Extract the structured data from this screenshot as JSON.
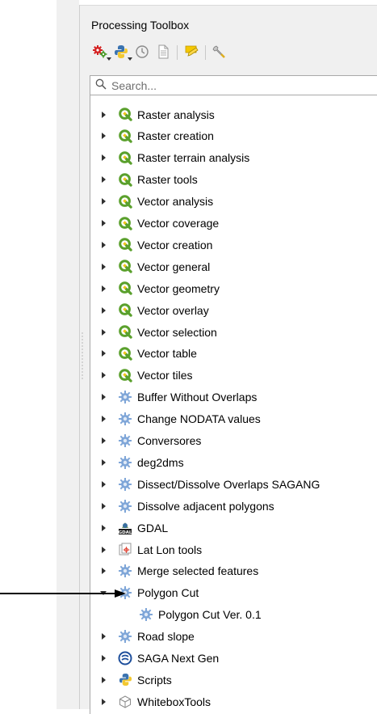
{
  "panel": {
    "title": "Processing Toolbox"
  },
  "toolbar": {
    "buttons": [
      {
        "name": "models-button",
        "icon": "gears-red-icon"
      },
      {
        "name": "scripts-button",
        "icon": "python-icon"
      },
      {
        "name": "history-button",
        "icon": "clock-icon"
      },
      {
        "name": "results-viewer-button",
        "icon": "document-icon"
      },
      {
        "name": "edit-features-in-place-button",
        "icon": "pencil-icon"
      },
      {
        "name": "options-button",
        "icon": "wrench-icon"
      }
    ]
  },
  "search": {
    "placeholder": "Search...",
    "value": ""
  },
  "tree": {
    "items": [
      {
        "label": "Raster analysis",
        "icon": "qgis-icon",
        "expanded": false
      },
      {
        "label": "Raster creation",
        "icon": "qgis-icon",
        "expanded": false
      },
      {
        "label": "Raster terrain analysis",
        "icon": "qgis-icon",
        "expanded": false
      },
      {
        "label": "Raster tools",
        "icon": "qgis-icon",
        "expanded": false
      },
      {
        "label": "Vector analysis",
        "icon": "qgis-icon",
        "expanded": false
      },
      {
        "label": "Vector coverage",
        "icon": "qgis-icon",
        "expanded": false
      },
      {
        "label": "Vector creation",
        "icon": "qgis-icon",
        "expanded": false
      },
      {
        "label": "Vector general",
        "icon": "qgis-icon",
        "expanded": false
      },
      {
        "label": "Vector geometry",
        "icon": "qgis-icon",
        "expanded": false
      },
      {
        "label": "Vector overlay",
        "icon": "qgis-icon",
        "expanded": false
      },
      {
        "label": "Vector selection",
        "icon": "qgis-icon",
        "expanded": false
      },
      {
        "label": "Vector table",
        "icon": "qgis-icon",
        "expanded": false
      },
      {
        "label": "Vector tiles",
        "icon": "qgis-icon",
        "expanded": false
      },
      {
        "label": "Buffer Without Overlaps",
        "icon": "gear-icon",
        "expanded": false
      },
      {
        "label": "Change NODATA values",
        "icon": "gear-icon",
        "expanded": false
      },
      {
        "label": "Conversores",
        "icon": "gear-icon",
        "expanded": false
      },
      {
        "label": "deg2dms",
        "icon": "gear-icon",
        "expanded": false
      },
      {
        "label": "Dissect/Dissolve Overlaps SAGANG",
        "icon": "gear-icon",
        "expanded": false
      },
      {
        "label": "Dissolve adjacent polygons",
        "icon": "gear-icon",
        "expanded": false
      },
      {
        "label": "GDAL",
        "icon": "gdal-icon",
        "expanded": false
      },
      {
        "label": "Lat Lon tools",
        "icon": "latlon-icon",
        "expanded": false
      },
      {
        "label": "Merge selected features",
        "icon": "gear-icon",
        "expanded": false
      },
      {
        "label": "Polygon Cut",
        "icon": "gear-icon",
        "expanded": true
      },
      {
        "label": "Polygon Cut Ver. 0.1",
        "icon": "gear-icon",
        "child": true
      },
      {
        "label": "Road slope",
        "icon": "gear-icon",
        "expanded": false
      },
      {
        "label": "SAGA Next Gen",
        "icon": "saga-icon",
        "expanded": false
      },
      {
        "label": "Scripts",
        "icon": "python-icon",
        "expanded": false
      },
      {
        "label": "WhiteboxTools",
        "icon": "whitebox-icon",
        "expanded": false
      }
    ]
  },
  "colors": {
    "qgis_green": "#5aa02c",
    "gear_blue": "#7fa6d8",
    "panel_bg": "#f0f0f0"
  }
}
